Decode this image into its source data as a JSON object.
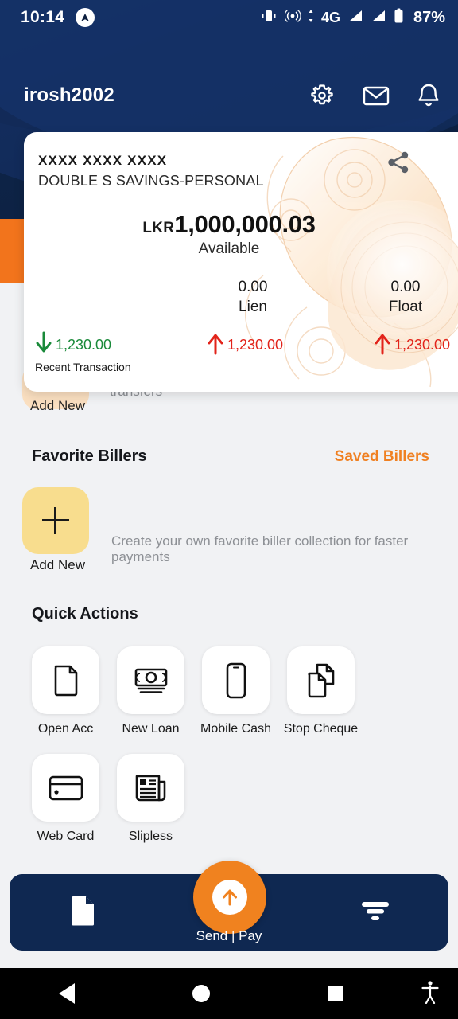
{
  "statusbar": {
    "time": "10:14",
    "app_icon": "app-logo-icon",
    "vibrate_icon": "vibrate-icon",
    "hotspot_icon": "hotspot-icon",
    "network": "4G",
    "signal_icon": "signal-bars-icon",
    "battery_icon": "battery-icon",
    "battery_level": "87%"
  },
  "header": {
    "username": "irosh2002",
    "icons": [
      {
        "name": "settings-icon",
        "label": "Settings"
      },
      {
        "name": "mail-icon",
        "label": "Messages"
      },
      {
        "name": "bell-icon",
        "label": "Notifications"
      }
    ]
  },
  "account_card": {
    "masked_number": "XXXX XXXX XXXX",
    "account_name": "DOUBLE S SAVINGS-PERSONAL",
    "currency": "LKR",
    "balance": "1,000,000.03",
    "balance_caption": "Available",
    "share_icon": "share-icon",
    "mini_stats": [
      {
        "value": "0.00",
        "label": "Lien"
      },
      {
        "value": "0.00",
        "label": "Float"
      }
    ],
    "trends": [
      {
        "direction": "down",
        "color": "#1a8a3a",
        "amount": "1,230.00",
        "caption": "Recent Transaction"
      },
      {
        "direction": "up",
        "color": "#e2231a",
        "amount": "1,230.00",
        "caption": ""
      },
      {
        "direction": "up",
        "color": "#e2231a",
        "amount": "1,230.00",
        "caption": ""
      }
    ]
  },
  "favorite_transfers": {
    "add_new_label": "Add New",
    "partial_text": "transfers"
  },
  "favorite_billers": {
    "title": "Favorite Billers",
    "link": "Saved Billers",
    "add_new_label": "Add New",
    "description": "Create your own favorite biller collection for faster payments"
  },
  "quick_actions": {
    "title": "Quick Actions",
    "items": [
      {
        "label": "Open Acc",
        "icon": "document-icon"
      },
      {
        "label": "New Loan",
        "icon": "banknote-icon"
      },
      {
        "label": "Mobile Cash",
        "icon": "mobile-phone-icon"
      },
      {
        "label": "Stop Cheque",
        "icon": "documents-stack-icon"
      },
      {
        "label": "Web Card",
        "icon": "credit-card-icon"
      },
      {
        "label": "Slipless",
        "icon": "receipt-icon"
      }
    ]
  },
  "bottom_nav": {
    "left_icon": "document-icon",
    "right_icon": "filter-icon",
    "fab_label": "Send | Pay",
    "fab_icon": "arrow-up-circle-icon"
  },
  "android_nav": {
    "back": "back-icon",
    "home": "home-icon",
    "recents": "recents-icon",
    "accessibility": "accessibility-icon"
  },
  "colors": {
    "navy": "#0c1f3f",
    "orange": "#f0821f",
    "card_bg": "#ffffff",
    "page_bg": "#f1f2f4",
    "biller_tile": "#f8dd8e",
    "green": "#1a8a3a",
    "red": "#e2231a"
  }
}
